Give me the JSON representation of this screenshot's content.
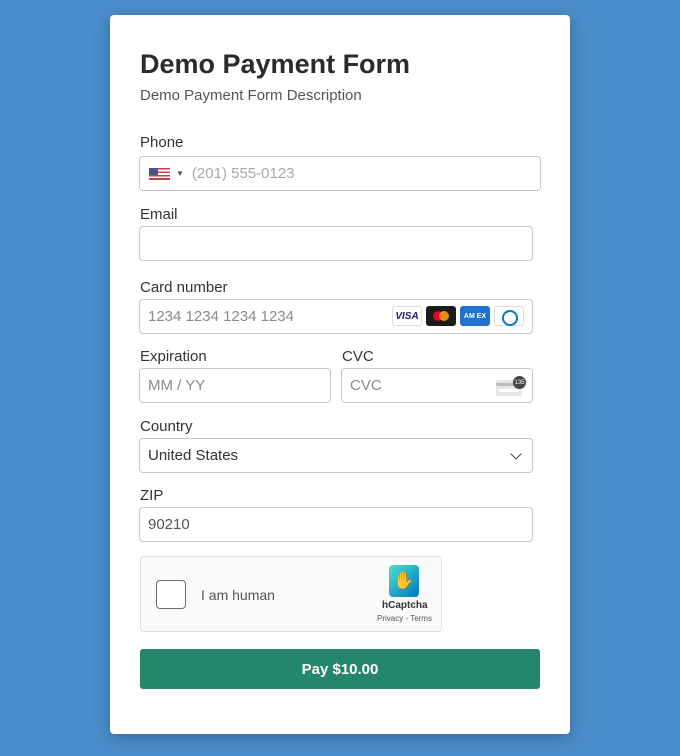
{
  "form": {
    "title": "Demo Payment Form",
    "description": "Demo Payment Form Description"
  },
  "phone": {
    "label": "Phone",
    "country_flag": "us-flag-icon",
    "placeholder": "(201) 555-0123",
    "value": ""
  },
  "email": {
    "label": "Email",
    "value": ""
  },
  "card": {
    "label": "Card number",
    "placeholder": "1234 1234 1234 1234",
    "brands": [
      "VISA",
      "Mastercard",
      "AMEX",
      "Diners"
    ],
    "amex_text": "AM EX"
  },
  "expiration": {
    "label": "Expiration",
    "placeholder": "MM / YY"
  },
  "cvc": {
    "label": "CVC",
    "placeholder": "CVC",
    "badge": "135"
  },
  "country": {
    "label": "Country",
    "selected": "United States"
  },
  "zip": {
    "label": "ZIP",
    "value": "90210"
  },
  "captcha": {
    "label": "I am human",
    "brand": "hCaptcha",
    "links": "Privacy - Terms"
  },
  "pay_button": {
    "label": "Pay $10.00",
    "color": "#24876a"
  },
  "colors": {
    "background": "#4a8ecb",
    "card": "#ffffff"
  }
}
